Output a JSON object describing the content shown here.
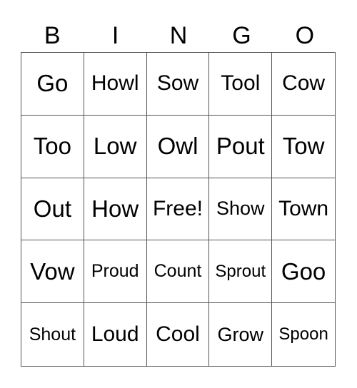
{
  "header": [
    "B",
    "I",
    "N",
    "G",
    "O"
  ],
  "cells": [
    "Go",
    "Howl",
    "Sow",
    "Tool",
    "Cow",
    "Too",
    "Low",
    "Owl",
    "Pout",
    "Tow",
    "Out",
    "How",
    "Free!",
    "Show",
    "Town",
    "Vow",
    "Proud",
    "Count",
    "Sprout",
    "Goo",
    "Shout",
    "Loud",
    "Cool",
    "Grow",
    "Spoon"
  ]
}
